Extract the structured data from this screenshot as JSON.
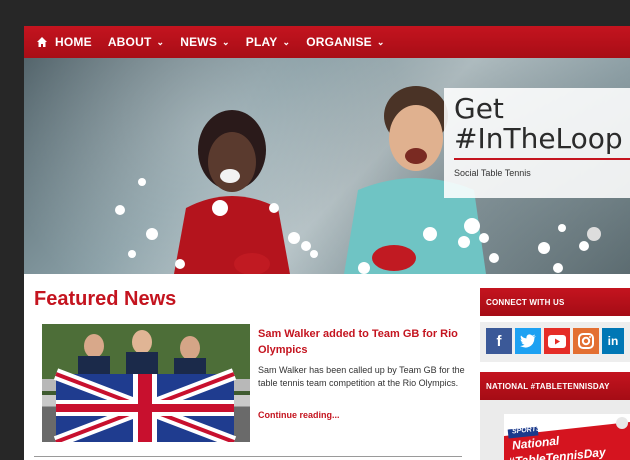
{
  "nav": {
    "items": [
      {
        "label": "HOME",
        "dropdown": false
      },
      {
        "label": "ABOUT",
        "dropdown": true
      },
      {
        "label": "NEWS",
        "dropdown": true
      },
      {
        "label": "PLAY",
        "dropdown": true
      },
      {
        "label": "ORGANISE",
        "dropdown": true
      }
    ],
    "caret": "⌄"
  },
  "hero": {
    "title_line1": "Get",
    "title_line2": "#InTheLoop",
    "subtitle": "Social Table Tennis"
  },
  "featured": {
    "section_title": "Featured News",
    "headline": "Sam Walker added to Team GB for Rio Olympics",
    "body": "Sam Walker has been called up by Team GB for the table tennis team competition at the Rio Olympics.",
    "more": "Continue reading..."
  },
  "sidebar": {
    "connect_title": "CONNECT WITH US",
    "social": [
      {
        "name": "facebook-icon",
        "glyph": "f",
        "color": "#3b5998"
      },
      {
        "name": "twitter-icon",
        "glyph": "t",
        "color": "#1da1f2"
      },
      {
        "name": "youtube-icon",
        "glyph": "▶",
        "color": "#e52d27"
      },
      {
        "name": "instagram-icon",
        "glyph": "◎",
        "color": "#e36f32"
      },
      {
        "name": "linkedin-icon",
        "glyph": "in",
        "color": "#0077b5"
      }
    ],
    "day_title": "NATIONAL #TABLETENNISDAY",
    "day_tag": "SPORTS",
    "day_line1": "National",
    "day_line2": "#TableTennisDay"
  },
  "colors": {
    "brand_red": "#c4141f",
    "page_bg": "#272727"
  }
}
